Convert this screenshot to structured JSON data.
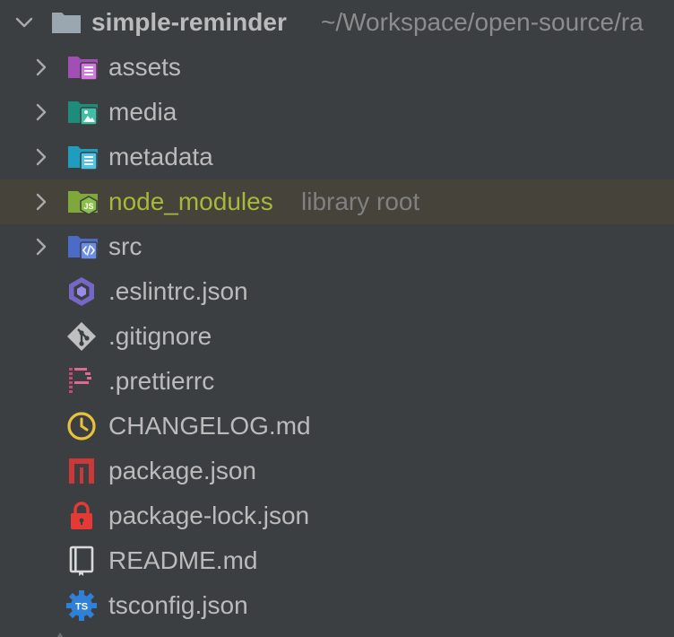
{
  "project": {
    "name": "simple-reminder",
    "path": "~/Workspace/open-source/ra"
  },
  "folders": [
    {
      "label": "assets",
      "icon": "resources-folder-icon"
    },
    {
      "label": "media",
      "icon": "image-folder-icon"
    },
    {
      "label": "metadata",
      "icon": "metadata-folder-icon"
    },
    {
      "label": "node_modules",
      "hint": "library root",
      "icon": "node-modules-folder-icon"
    },
    {
      "label": "src",
      "icon": "source-folder-icon"
    }
  ],
  "files": [
    {
      "label": ".eslintrc.json",
      "icon": "eslint-icon"
    },
    {
      "label": ".gitignore",
      "icon": "git-icon"
    },
    {
      "label": ".prettierrc",
      "icon": "prettier-icon"
    },
    {
      "label": "CHANGELOG.md",
      "icon": "changelog-clock-icon"
    },
    {
      "label": "package.json",
      "icon": "npm-icon"
    },
    {
      "label": "package-lock.json",
      "icon": "lock-icon"
    },
    {
      "label": "README.md",
      "icon": "readme-book-icon"
    },
    {
      "label": "tsconfig.json",
      "icon": "typescript-config-icon"
    }
  ],
  "colors": {
    "background": "#3c3f41",
    "text": "#bbbbbb",
    "path": "#8c8c8c",
    "node_modules_text": "#a9b73c",
    "node_modules_row": "#45433a"
  }
}
